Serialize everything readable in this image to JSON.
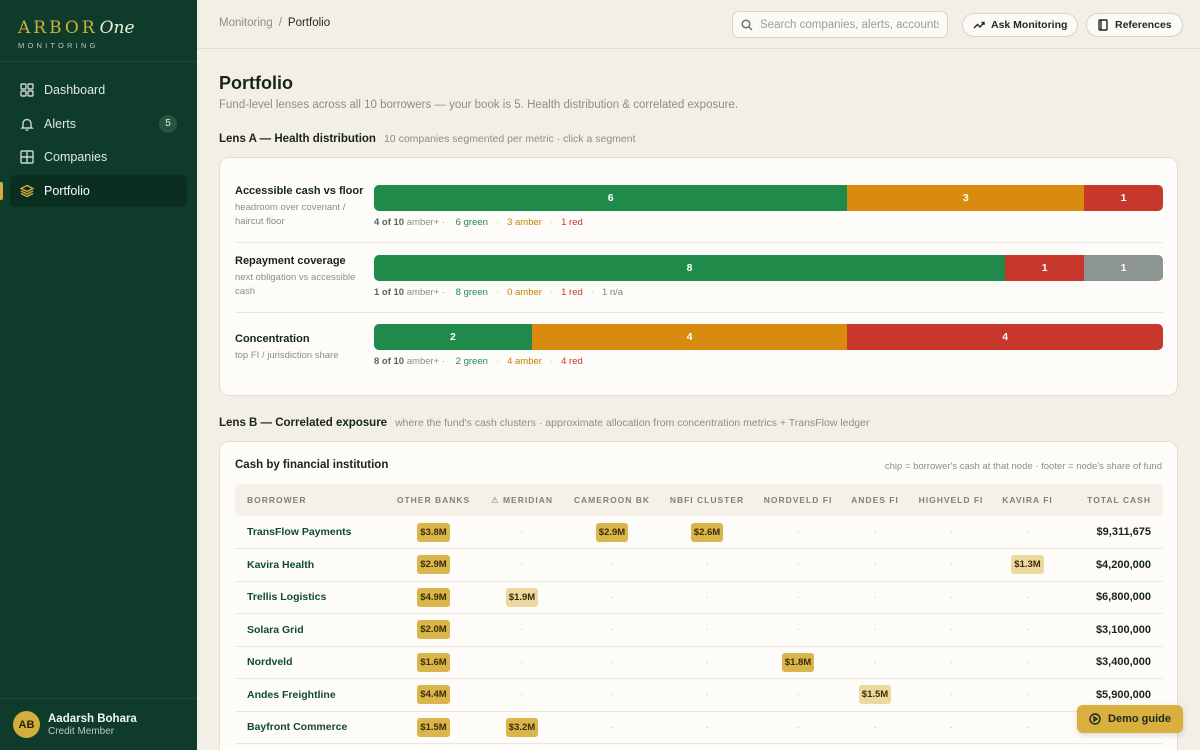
{
  "brand": {
    "name": "ARBOR",
    "suffix": "One",
    "sub": "MONITORING"
  },
  "sidebar": {
    "items": [
      {
        "label": "Dashboard",
        "icon": "dashboard-icon"
      },
      {
        "label": "Alerts",
        "icon": "bell-icon",
        "badge": "5"
      },
      {
        "label": "Companies",
        "icon": "grid-icon"
      },
      {
        "label": "Portfolio",
        "icon": "layers-icon",
        "active": true
      }
    ]
  },
  "user": {
    "initials": "AB",
    "name": "Aadarsh Bohara",
    "role": "Credit Member"
  },
  "topbar": {
    "breadcrumb": [
      "Monitoring",
      "Portfolio"
    ],
    "search_placeholder": "Search companies, alerts, accounts...",
    "ask_label": "Ask Monitoring",
    "ref_label": "References"
  },
  "page": {
    "title": "Portfolio",
    "subtitle": "Fund-level lenses across all 10 borrowers — your book is 5. Health distribution & correlated exposure."
  },
  "lens_a": {
    "title": "Lens A — Health distribution",
    "hint": "10 companies segmented per metric · click a segment",
    "metrics": [
      {
        "name": "Accessible cash vs floor",
        "desc": "headroom over covenant / haircut floor",
        "segments": [
          {
            "kind": "green",
            "value": 6
          },
          {
            "kind": "amber",
            "value": 3
          },
          {
            "kind": "red",
            "value": 1
          }
        ],
        "count": "4 of 10",
        "count_suffix": "amber+ ·",
        "legend": {
          "green": "6 green",
          "amber": "3 amber",
          "red": "1 red"
        }
      },
      {
        "name": "Repayment coverage",
        "desc": "next obligation vs accessible cash",
        "segments": [
          {
            "kind": "green",
            "value": 8
          },
          {
            "kind": "red",
            "value": 1
          },
          {
            "kind": "na",
            "value": 1
          }
        ],
        "count": "1 of 10",
        "count_suffix": "amber+ ·",
        "legend": {
          "green": "8 green",
          "amber": "0 amber",
          "red": "1 red",
          "na": "1 n/a"
        }
      },
      {
        "name": "Concentration",
        "desc": "top FI / jurisdiction share",
        "segments": [
          {
            "kind": "green",
            "value": 2
          },
          {
            "kind": "amber",
            "value": 4
          },
          {
            "kind": "red",
            "value": 4
          }
        ],
        "count": "8 of 10",
        "count_suffix": "amber+ ·",
        "legend": {
          "green": "2 green",
          "amber": "4 amber",
          "red": "4 red"
        }
      }
    ]
  },
  "lens_b": {
    "title": "Lens B — Correlated exposure",
    "hint": "where the fund's cash clusters · approximate allocation from concentration metrics + TransFlow ledger",
    "card_title": "Cash by financial institution",
    "card_note": "chip = borrower's cash at that node · footer = node's share of fund",
    "columns": [
      "Borrower",
      "Other banks",
      "⚠ Meridian",
      "Cameroon BK",
      "NBFI Cluster",
      "Nordveld FI",
      "Andes FI",
      "Highveld FI",
      "Kavira FI",
      "Total cash"
    ],
    "rows": [
      {
        "name": "TransFlow Payments",
        "cells": [
          {
            "v": "$3.8M",
            "s": "strong"
          },
          null,
          {
            "v": "$2.9M",
            "s": "strong"
          },
          {
            "v": "$2.6M",
            "s": "strong"
          },
          null,
          null,
          null,
          null
        ],
        "total": "$9,311,675"
      },
      {
        "name": "Kavira Health",
        "cells": [
          {
            "v": "$2.9M",
            "s": "strong"
          },
          null,
          null,
          null,
          null,
          null,
          null,
          {
            "v": "$1.3M",
            "s": "light"
          }
        ],
        "total": "$4,200,000"
      },
      {
        "name": "Trellis Logistics",
        "cells": [
          {
            "v": "$4.9M",
            "s": "strong"
          },
          {
            "v": "$1.9M",
            "s": "light"
          },
          null,
          null,
          null,
          null,
          null,
          null
        ],
        "total": "$6,800,000"
      },
      {
        "name": "Solara Grid",
        "cells": [
          {
            "v": "$2.0M",
            "s": "strong"
          },
          null,
          null,
          null,
          null,
          null,
          null,
          null
        ],
        "total": "$3,100,000"
      },
      {
        "name": "Nordveld",
        "cells": [
          {
            "v": "$1.6M",
            "s": "strong"
          },
          null,
          null,
          null,
          {
            "v": "$1.8M",
            "s": "strong"
          },
          null,
          null,
          null
        ],
        "total": "$3,400,000"
      },
      {
        "name": "Andes Freightline",
        "cells": [
          {
            "v": "$4.4M",
            "s": "strong"
          },
          null,
          null,
          null,
          null,
          {
            "v": "$1.5M",
            "s": "light"
          },
          null,
          null
        ],
        "total": "$5,900,000"
      },
      {
        "name": "Bayfront Commerce",
        "cells": [
          {
            "v": "$1.5M",
            "s": "strong"
          },
          {
            "v": "$3.2M",
            "s": "strong"
          },
          null,
          null,
          null,
          null,
          null,
          null
        ],
        "total": ""
      }
    ],
    "empty_cell": "·"
  },
  "demo_label": "Demo guide"
}
